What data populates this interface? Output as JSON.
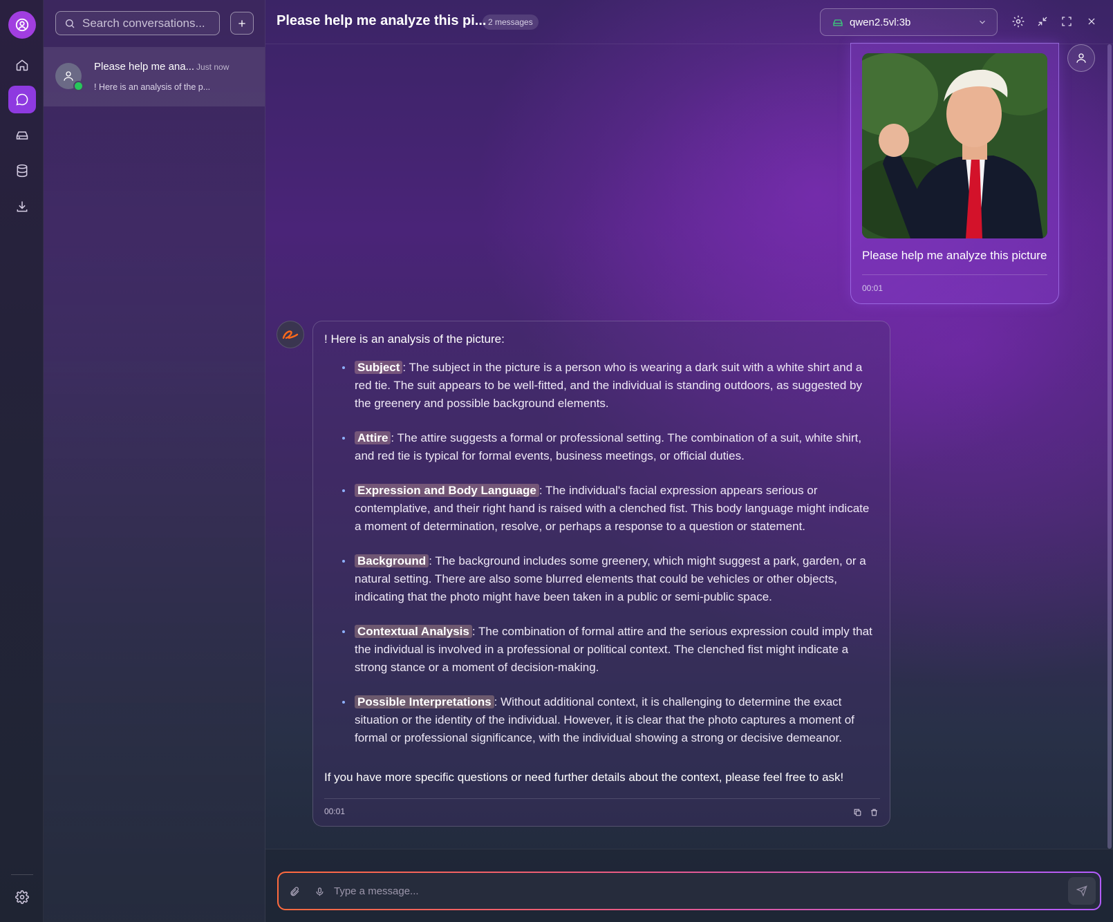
{
  "search": {
    "placeholder": "Search conversations..."
  },
  "conversations": [
    {
      "title": "Please help me ana...",
      "time": "Just now",
      "preview": "! Here is an analysis of the p..."
    }
  ],
  "header": {
    "title": "Please help me analyze this pi...",
    "message_count": "2 messages",
    "model": "qwen2.5vl:3b"
  },
  "user_message": {
    "text": "Please help me analyze this picture",
    "time": "00:01"
  },
  "assistant_message": {
    "intro": "! Here is an analysis of the picture:",
    "items": [
      {
        "term": "Subject",
        "text": ": The subject in the picture is a person who is wearing a dark suit with a white shirt and a red tie. The suit appears to be well-fitted, and the individual is standing outdoors, as suggested by the greenery and possible background elements."
      },
      {
        "term": "Attire",
        "text": ": The attire suggests a formal or professional setting. The combination of a suit, white shirt, and red tie is typical for formal events, business meetings, or official duties."
      },
      {
        "term": "Expression and Body Language",
        "text": ": The individual's facial expression appears serious or contemplative, and their right hand is raised with a clenched fist. This body language might indicate a moment of determination, resolve, or perhaps a response to a question or statement."
      },
      {
        "term": "Background",
        "text": ": The background includes some greenery, which might suggest a park, garden, or a natural setting. There are also some blurred elements that could be vehicles or other objects, indicating that the photo might have been taken in a public or semi-public space."
      },
      {
        "term": "Contextual Analysis",
        "text": ": The combination of formal attire and the serious expression could imply that the individual is involved in a professional or political context. The clenched fist might indicate a strong stance or a moment of decision-making."
      },
      {
        "term": "Possible Interpretations",
        "text": ": Without additional context, it is challenging to determine the exact situation or the identity of the individual. However, it is clear that the photo captures a moment of formal or professional significance, with the individual showing a strong or decisive demeanor."
      }
    ],
    "outro": "If you have more specific questions or need further details about the context, please feel free to ask!",
    "time": "00:01"
  },
  "composer": {
    "placeholder": "Type a message..."
  },
  "icons": {
    "rail": [
      "app-logo-icon",
      "home-icon",
      "chat-icon",
      "inbox-icon",
      "database-icon",
      "download-icon",
      "settings-icon"
    ],
    "header": [
      "settings-icon",
      "minimize-icon",
      "fullscreen-icon",
      "close-icon"
    ]
  },
  "colors": {
    "accent": "#8e3ae0",
    "online": "#27c65a",
    "highlight": "#ffc8aa"
  }
}
